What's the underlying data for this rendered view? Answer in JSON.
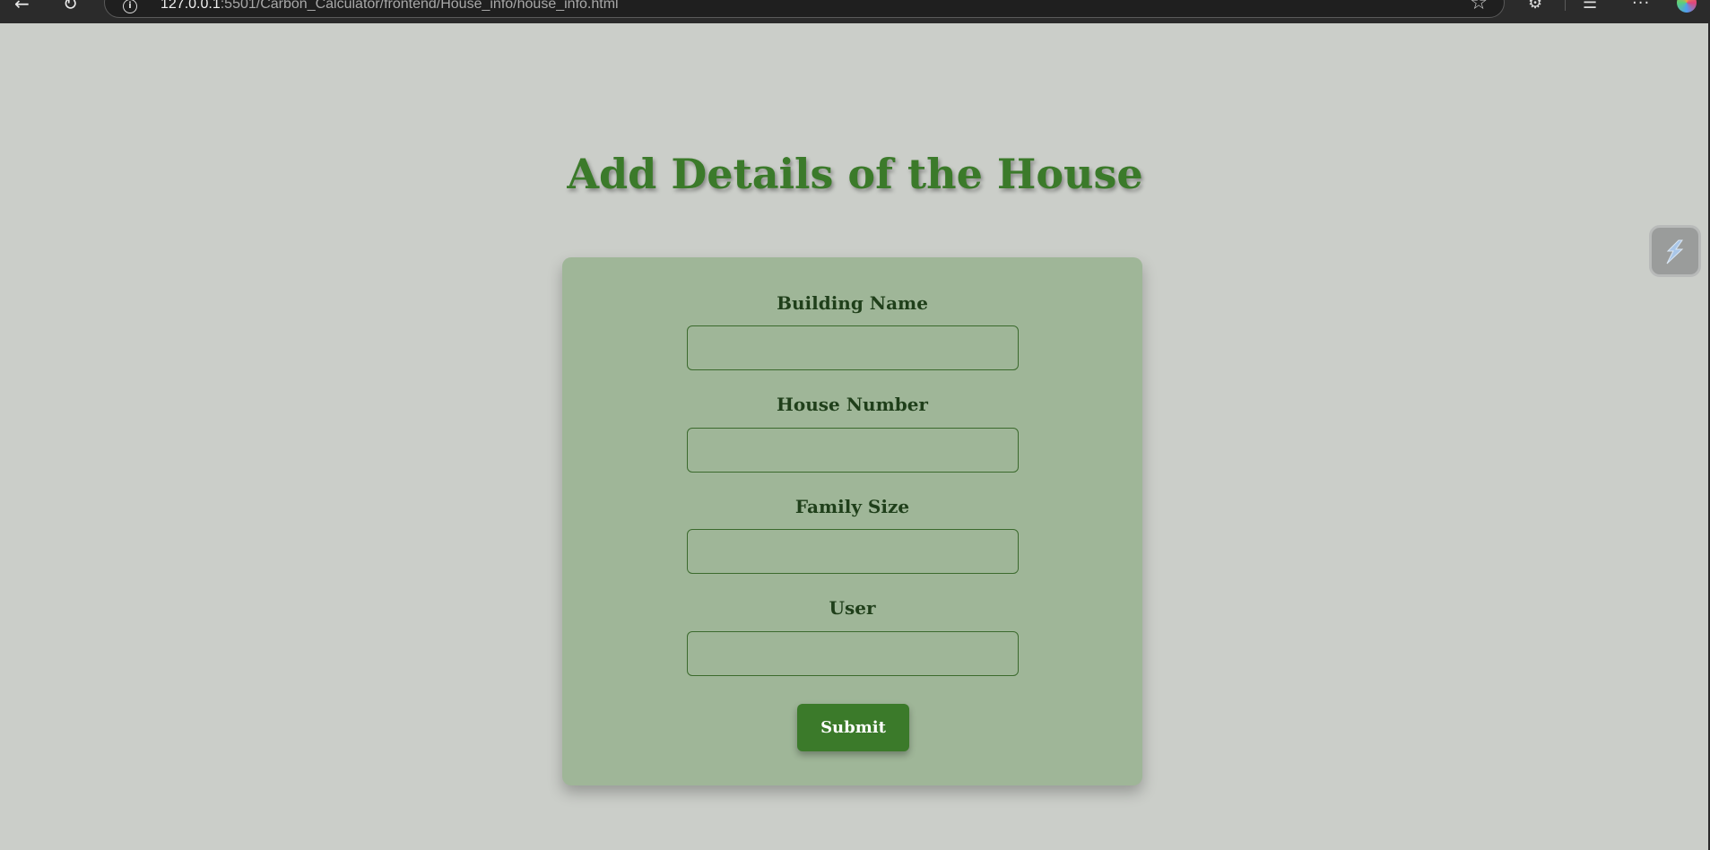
{
  "browser": {
    "back_glyph": "←",
    "reload_glyph": "↻",
    "url_host": "127.0.0.1",
    "url_rest": ":5501/Carbon_Calculator/frontend/House_info/house_info.html",
    "info_glyph": "i",
    "star_glyph": "☆",
    "extensions_glyph": "⚙",
    "favorites_glyph": "☰",
    "more_glyph": "···"
  },
  "page": {
    "title": "Add Details of the House"
  },
  "form": {
    "fields": [
      {
        "label": "Building Name",
        "value": "",
        "placeholder": ""
      },
      {
        "label": "House Number",
        "value": "",
        "placeholder": ""
      },
      {
        "label": "Family Size",
        "value": "",
        "placeholder": ""
      },
      {
        "label": "User",
        "value": "",
        "placeholder": ""
      }
    ],
    "submit_label": "Submit"
  },
  "colors": {
    "page_background": "#cbcec9",
    "card_background": "#9fb698",
    "title_green": "#3b7a2a",
    "label_dark_green": "#1f3f1a",
    "button_green": "#3b7a2a"
  }
}
